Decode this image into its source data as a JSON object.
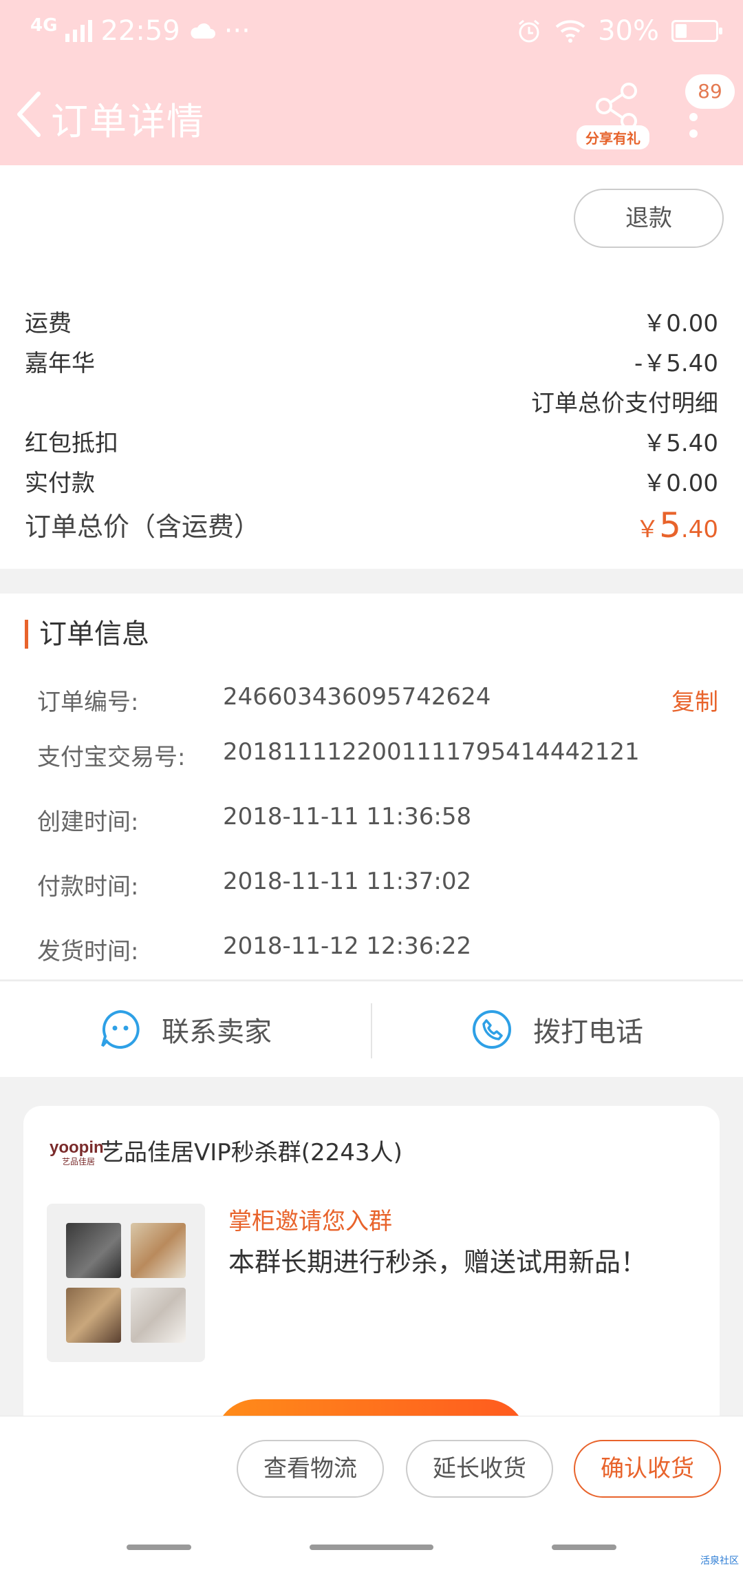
{
  "status_bar": {
    "network": "4G",
    "time": "22:59",
    "more": "···",
    "battery_pct": "30%",
    "battery_level": 0.3
  },
  "nav": {
    "title": "订单详情",
    "share_label": "分享有礼",
    "badge_count": "89"
  },
  "actions": {
    "refund": "退款"
  },
  "price": {
    "rows": [
      {
        "label": "运费",
        "value": "￥0.00"
      },
      {
        "label": "嘉年华",
        "value": "-￥5.40"
      },
      {
        "label": "",
        "value": "订单总价支付明细"
      },
      {
        "label": "红包抵扣",
        "value": "￥5.40"
      },
      {
        "label": "实付款",
        "value": "￥0.00"
      }
    ],
    "total_label": "订单总价（含运费）",
    "total_symbol": "￥",
    "total_int": "5",
    "total_dec": ".40"
  },
  "order_info": {
    "title": "订单信息",
    "copy_label": "复制",
    "rows": [
      {
        "label": "订单编号:",
        "value": "246603436095742624"
      },
      {
        "label": "支付宝交易号:",
        "value": "2018111122001111795414442121"
      },
      {
        "label": "创建时间:",
        "value": "2018-11-11 11:36:58"
      },
      {
        "label": "付款时间:",
        "value": "2018-11-11 11:37:02"
      },
      {
        "label": "发货时间:",
        "value": "2018-11-12 12:36:22"
      }
    ]
  },
  "contact": {
    "seller": "联系卖家",
    "phone": "拨打电话"
  },
  "group": {
    "logo_text": "yoopin",
    "logo_sub": "艺品佳居",
    "name": "艺品佳居VIP秒杀群(2243人)",
    "invite_title": "掌柜邀请您入群",
    "invite_desc": "本群长期进行秒杀，赠送试用新品！"
  },
  "bottom": {
    "logistics": "查看物流",
    "extend": "延长收货",
    "confirm": "确认收货"
  },
  "watermark": "活泉社区",
  "colors": {
    "header_bg": "#ffd7d9",
    "accent": "#e8632b",
    "contact_icon": "#2ea0e6"
  }
}
